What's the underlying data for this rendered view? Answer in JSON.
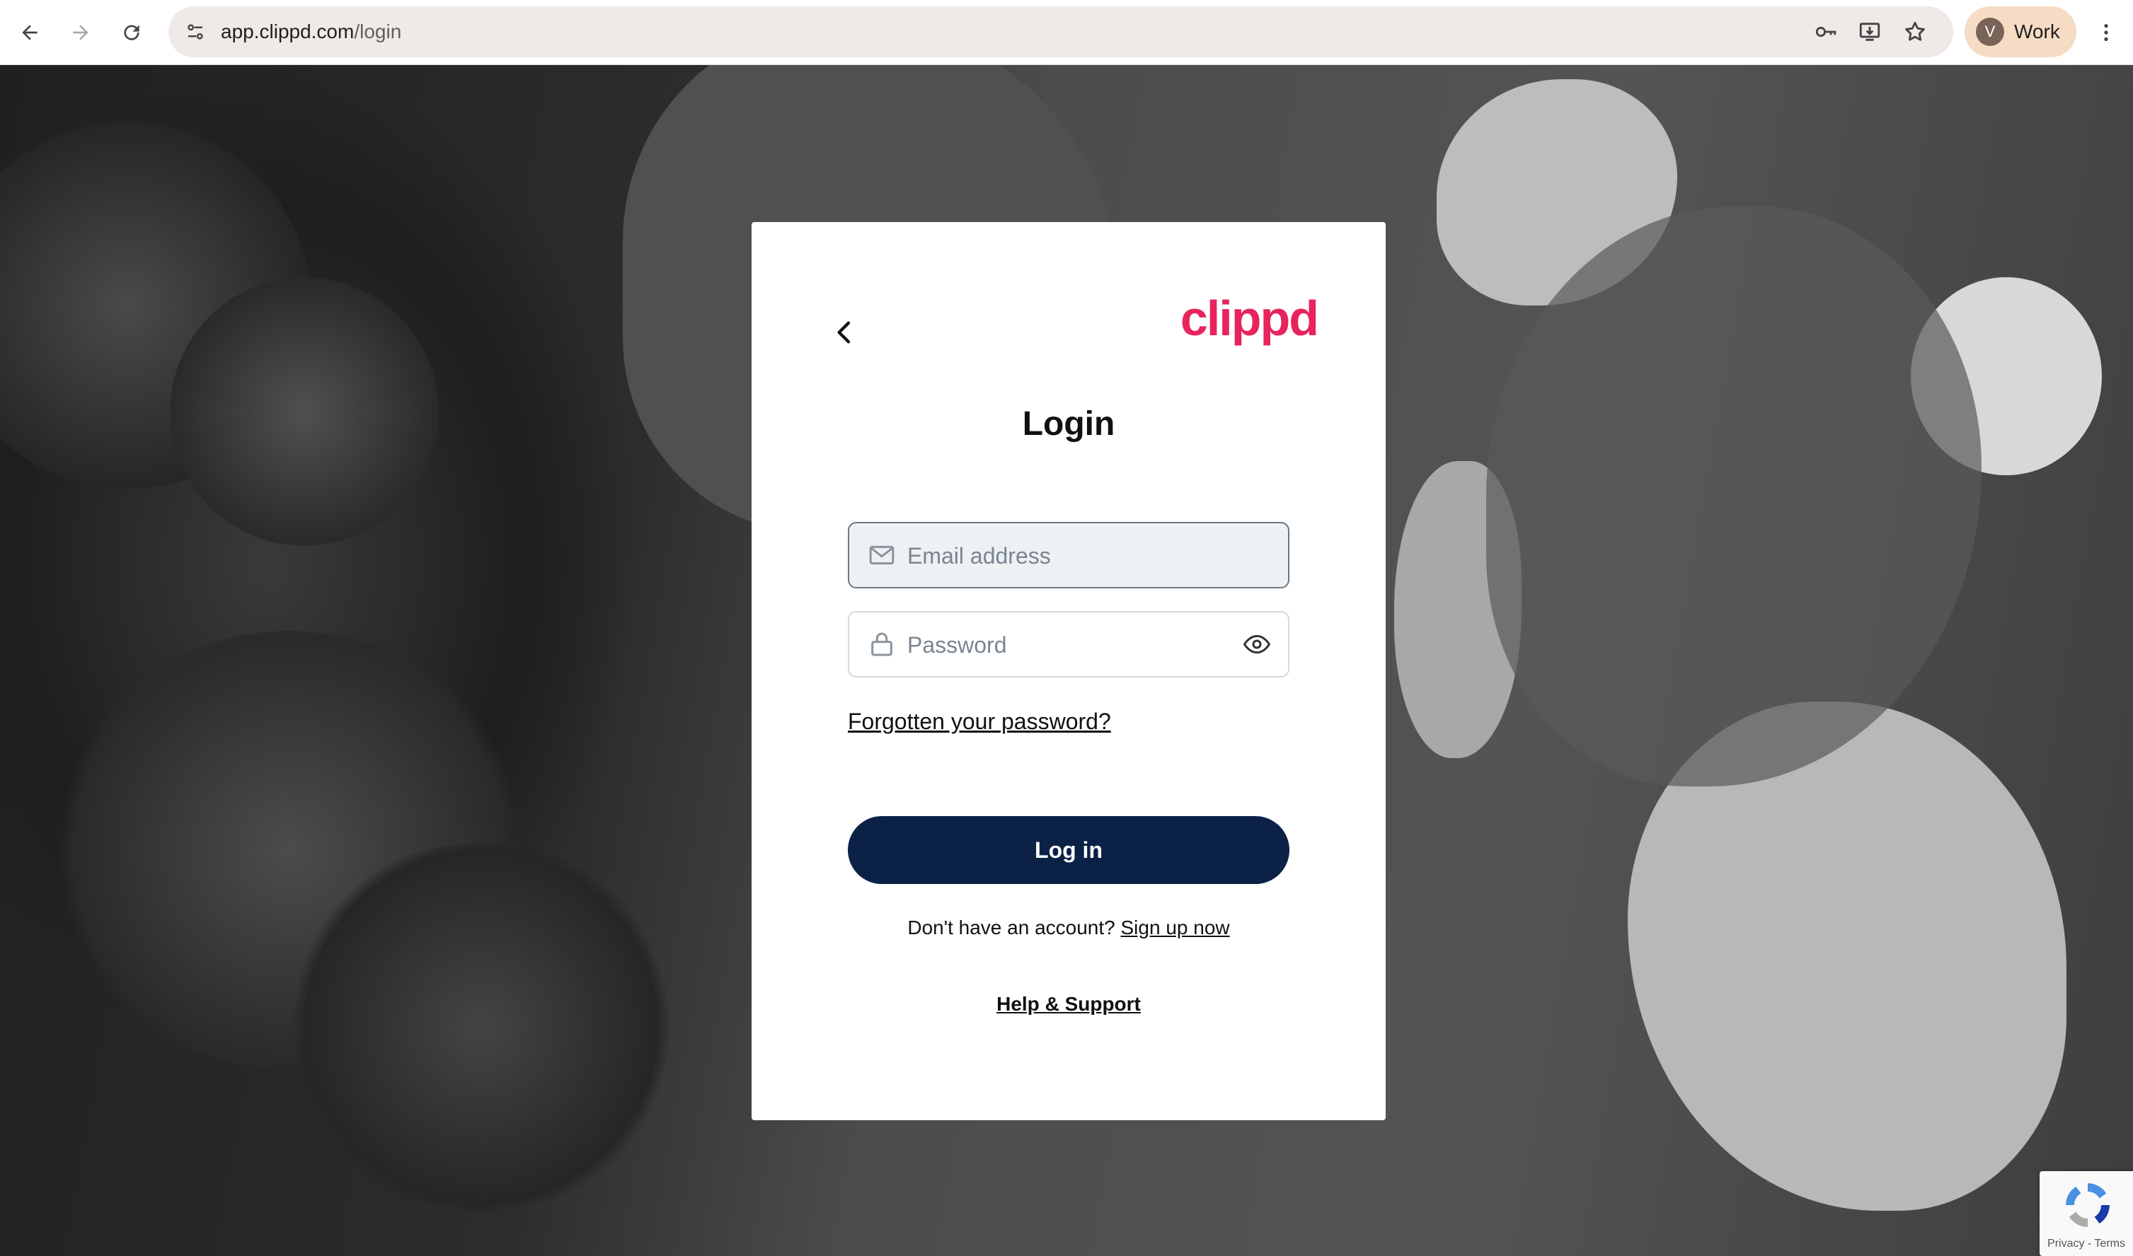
{
  "browser": {
    "url_host": "app.clippd.com",
    "url_path": "/login",
    "profile_initial": "V",
    "profile_label": "Work",
    "icons": [
      "back-arrow-icon",
      "forward-arrow-icon",
      "reload-icon",
      "site-info-icon",
      "password-key-icon",
      "install-app-icon",
      "bookmark-star-icon",
      "more-vert-icon"
    ]
  },
  "login": {
    "logo": "clippd",
    "title": "Login",
    "email_placeholder": "Email address",
    "password_placeholder": "Password",
    "forgot_link": "Forgotten your password?",
    "submit_label": "Log in",
    "no_account_text": "Don't have an account?",
    "signup_link": "Sign up now",
    "help_link": "Help & Support"
  },
  "recaptcha": {
    "links": "Privacy - Terms"
  },
  "colors": {
    "brand": "#e8245c",
    "button": "#0c2146"
  }
}
